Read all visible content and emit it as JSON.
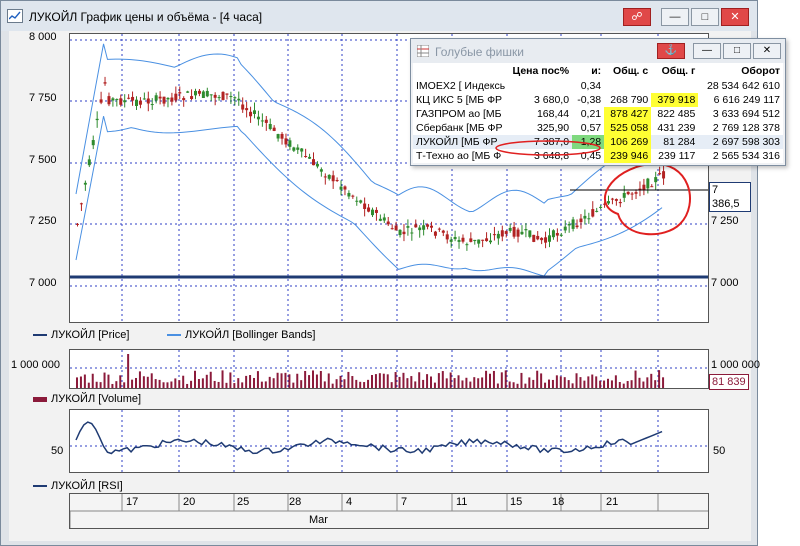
{
  "window": {
    "title": "ЛУКОЙЛ График цены и объёма - [4 часа]",
    "buttons": {
      "link": "☍",
      "minimize": "—",
      "maximize": "□",
      "close": "✕"
    }
  },
  "price_axis": {
    "ticks": [
      "8 000",
      "7 750",
      "7 500",
      "7 250",
      "7 000"
    ],
    "right_ticks": [
      "7 250",
      "7 000"
    ],
    "last_price": "7 386,5"
  },
  "volume_axis": {
    "tick_left": "1 000 000",
    "tick_right": "1 000 000",
    "last_volume": "81 839"
  },
  "rsi_axis": {
    "tick_left": "50",
    "tick_right": "50"
  },
  "legends": {
    "price": "ЛУКОЙЛ [Price]",
    "bollinger": "ЛУКОЙЛ [Bollinger Bands]",
    "volume": "ЛУКОЙЛ [Volume]",
    "rsi": "ЛУКОЙЛ [RSI]"
  },
  "time_axis": {
    "days": [
      "17",
      "20",
      "25",
      "28",
      "4",
      "7",
      "11",
      "15",
      "18",
      "21"
    ],
    "month": "Mar"
  },
  "colors": {
    "price_line": "#1f3b73",
    "bollinger": "#4a90e2",
    "candle_up": "#2e8b2e",
    "candle_down": "#b22222",
    "volume": "#8b1a3a",
    "support": "#1f3b73",
    "annotation": "#e02020"
  },
  "popup": {
    "title": "Голубые фишки",
    "columns": [
      "",
      "Цена пос%",
      "и:",
      "Общ. с",
      "Общ. г",
      "Оборот"
    ],
    "rows": [
      {
        "name": "IMOEX2 [ Индексы",
        "price": "",
        "change": "0,34",
        "vol_s": "",
        "vol_g": "",
        "turnover": "28 534 642 610"
      },
      {
        "name": "КЦ ИКС 5 [МБ ФР",
        "price": "3 680,0",
        "change": "-0,38",
        "vol_s": "268 790",
        "vol_g": "379 918",
        "turnover": "6 616 249 117"
      },
      {
        "name": "ГАЗПРОМ ао [МБ",
        "price": "168,44",
        "change": "0,21",
        "vol_s": "878 427",
        "vol_g": "822 485",
        "turnover": "3 633 694 512"
      },
      {
        "name": "Сбербанк [МБ ФР",
        "price": "325,90",
        "change": "0,57",
        "vol_s": "525 058",
        "vol_g": "431 239",
        "turnover": "2 769 128 378"
      },
      {
        "name": "ЛУКОЙЛ [МБ ФР",
        "price": "7 387,0",
        "change": "1,28",
        "vol_s": "106 269",
        "vol_g": "81 284",
        "turnover": "2 697 598 303"
      },
      {
        "name": "Т-Техно ао [МБ Ф",
        "price": "3 648,8",
        "change": "0,45",
        "vol_s": "239 946",
        "vol_g": "239 117",
        "turnover": "2 565 534 316"
      }
    ]
  }
}
